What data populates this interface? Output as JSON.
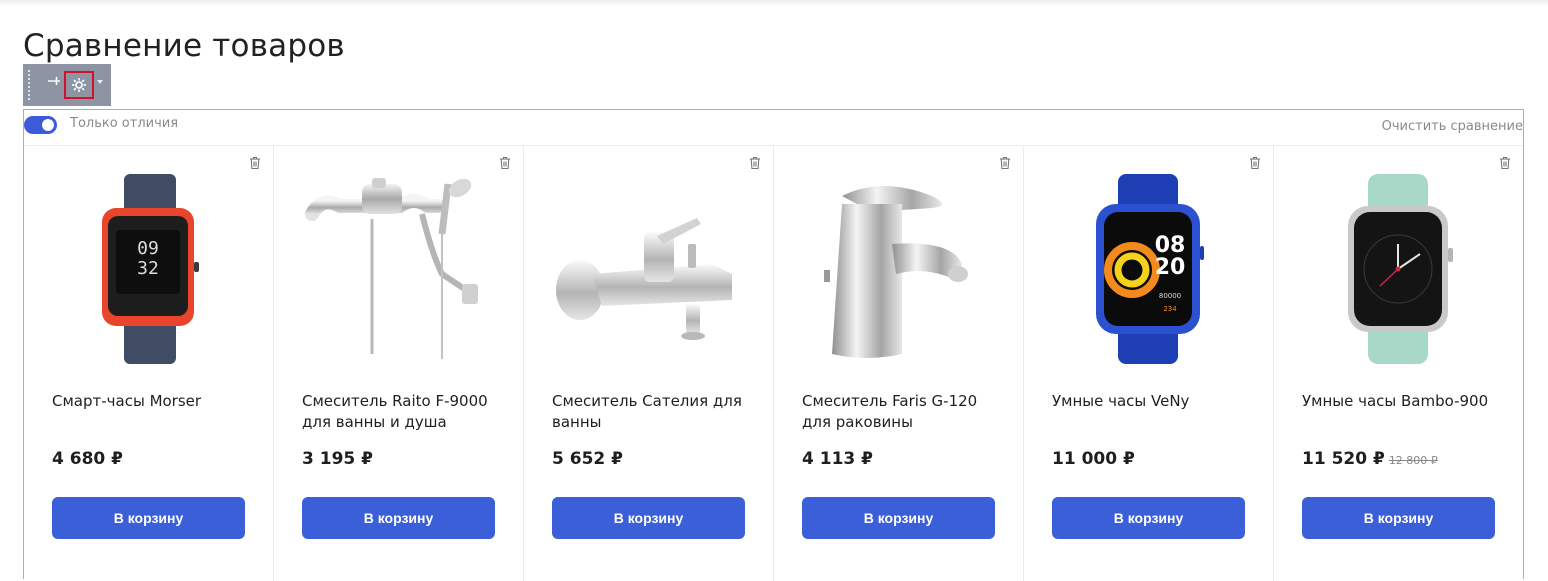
{
  "page_title": "Сравнение товаров",
  "admin_toolbar": {
    "pin_icon": "pin-icon",
    "gear_icon": "gear-icon",
    "caret_icon": "caret-down-icon"
  },
  "compare": {
    "only_differences_label": "Только отличия",
    "only_differences_enabled": true,
    "clear_label": "Очистить сравнение",
    "accent_color": "#3a5fd9"
  },
  "products": [
    {
      "name": "Смарт-часы Morser",
      "price": "4 680 ₽",
      "old_price": "",
      "button": "В корзину",
      "image": "orange-smartwatch"
    },
    {
      "name": "Смеситель Raito F-9000 для ванны и душа",
      "price": "3 195 ₽",
      "old_price": "",
      "button": "В корзину",
      "image": "bath-shower-mixer-long-spout"
    },
    {
      "name": "Смеситель Сателия для ванны",
      "price": "5 652 ₽",
      "old_price": "",
      "button": "В корзину",
      "image": "bath-mixer"
    },
    {
      "name": "Смеситель Faris G-120 для раковины",
      "price": "4 113 ₽",
      "old_price": "",
      "button": "В корзину",
      "image": "sink-mixer"
    },
    {
      "name": "Умные часы VeNy",
      "price": "11 000 ₽",
      "old_price": "",
      "button": "В корзину",
      "image": "blue-smartwatch",
      "watch_time": [
        "08",
        "20"
      ],
      "watch_stats": [
        "80000",
        "234"
      ]
    },
    {
      "name": "Умные часы Bambo-900",
      "price": "11 520 ₽",
      "old_price": "12 800 ₽",
      "button": "В корзину",
      "image": "mint-smartwatch"
    }
  ],
  "watch1_time": [
    "09",
    "32"
  ]
}
